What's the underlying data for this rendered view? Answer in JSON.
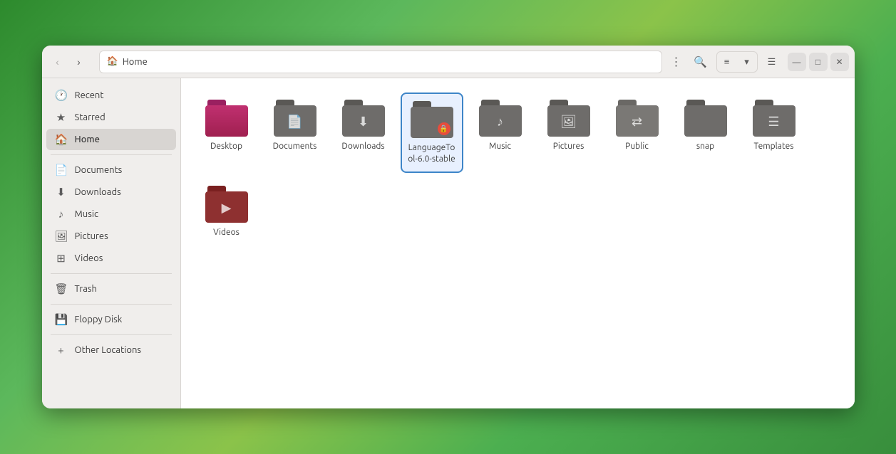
{
  "window": {
    "title": "Home",
    "breadcrumb_icon": "🏠"
  },
  "nav": {
    "back_label": "‹",
    "forward_label": "›",
    "menu_label": "⋮",
    "search_label": "🔍",
    "view_list_label": "≡",
    "view_dropdown_label": "▾",
    "view_menu_label": "☰",
    "minimize_label": "—",
    "maximize_label": "□",
    "close_label": "✕"
  },
  "sidebar": {
    "items": [
      {
        "id": "recent",
        "label": "Recent",
        "icon": "🕐"
      },
      {
        "id": "starred",
        "label": "Starred",
        "icon": "★"
      },
      {
        "id": "home",
        "label": "Home",
        "icon": "🏠",
        "active": true
      },
      {
        "id": "documents",
        "label": "Documents",
        "icon": "📄"
      },
      {
        "id": "downloads",
        "label": "Downloads",
        "icon": "⬇"
      },
      {
        "id": "music",
        "label": "Music",
        "icon": "♪"
      },
      {
        "id": "pictures",
        "label": "Pictures",
        "icon": "🖼"
      },
      {
        "id": "videos",
        "label": "Videos",
        "icon": "⊞"
      },
      {
        "id": "trash",
        "label": "Trash",
        "icon": "🗑"
      },
      {
        "id": "floppy",
        "label": "Floppy Disk",
        "icon": "💾"
      },
      {
        "id": "other",
        "label": "Other Locations",
        "icon": "+"
      }
    ]
  },
  "files": [
    {
      "id": "desktop",
      "label": "Desktop",
      "type": "folder-pink",
      "icon": ""
    },
    {
      "id": "documents",
      "label": "Documents",
      "type": "folder-dark",
      "icon": "📄"
    },
    {
      "id": "downloads",
      "label": "Downloads",
      "type": "folder-dark",
      "icon": "⬇"
    },
    {
      "id": "languagetool",
      "label": "LanguageTool-6.0-stable",
      "type": "folder-locked",
      "icon": "🔒",
      "selected": true
    },
    {
      "id": "music",
      "label": "Music",
      "type": "folder-music",
      "icon": "♪"
    },
    {
      "id": "pictures",
      "label": "Pictures",
      "type": "folder-pictures",
      "icon": "🖼"
    },
    {
      "id": "public",
      "label": "Public",
      "type": "folder-share",
      "icon": "⇄"
    },
    {
      "id": "snap",
      "label": "snap",
      "type": "folder-snap",
      "icon": ""
    },
    {
      "id": "templates",
      "label": "Templates",
      "type": "folder-templates",
      "icon": "☰"
    },
    {
      "id": "videos",
      "label": "Videos",
      "type": "folder-videos",
      "icon": "▶"
    }
  ]
}
